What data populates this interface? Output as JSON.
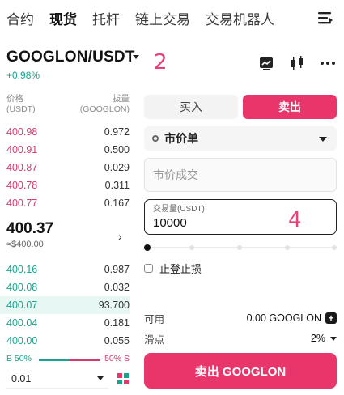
{
  "nav": {
    "tabs": [
      {
        "label": "合约",
        "active": false
      },
      {
        "label": "现货",
        "active": true
      },
      {
        "label": "托杆",
        "active": false
      },
      {
        "label": "链上交易",
        "active": false
      },
      {
        "label": "交易机器人",
        "active": false
      }
    ],
    "menu_icon": "menu-lines-icon"
  },
  "pair": {
    "symbol": "GOOGLON/USDT",
    "change": "+0.98%",
    "annotation": "2"
  },
  "header_icons": [
    "chart-compare-icon",
    "candlestick-icon",
    "more-dots-icon"
  ],
  "book": {
    "price_header": "价格",
    "price_unit": "(USDT)",
    "qty_header": "拔量",
    "qty_unit": "(GOOGLON)",
    "asks": [
      {
        "price": "400.98",
        "qty": "0.972"
      },
      {
        "price": "400.91",
        "qty": "0.500"
      },
      {
        "price": "400.87",
        "qty": "0.029"
      },
      {
        "price": "400.78",
        "qty": "0.311"
      },
      {
        "price": "400.77",
        "qty": "0.167"
      }
    ],
    "last_price": "400.37",
    "last_fiat": "≈$400.00",
    "bids": [
      {
        "price": "400.16",
        "qty": "0.987"
      },
      {
        "price": "400.08",
        "qty": "0.032"
      },
      {
        "price": "400.07",
        "qty": "93.700"
      },
      {
        "price": "400.04",
        "qty": "0.181"
      },
      {
        "price": "400.00",
        "qty": "0.055"
      }
    ],
    "buy_ratio": "B 50%",
    "sell_ratio": "50% S",
    "depth": "0.01"
  },
  "form": {
    "buy_label": "买入",
    "sell_label": "卖出",
    "order_type": "市价单",
    "market_price_placeholder": "市价成交",
    "amount_label": "交易量(USDT)",
    "amount_value": "10000",
    "annotation": "4",
    "tpsl_label": "止登止损",
    "available_label": "可用",
    "available_value": "0.00 GOOGLON",
    "slippage_label": "滑点",
    "slippage_value": "2%",
    "submit_label": "卖出 GOOGLON"
  },
  "colors": {
    "sell": "#e8366b",
    "buy": "#1aa38a",
    "annotation": "#e8407a"
  }
}
